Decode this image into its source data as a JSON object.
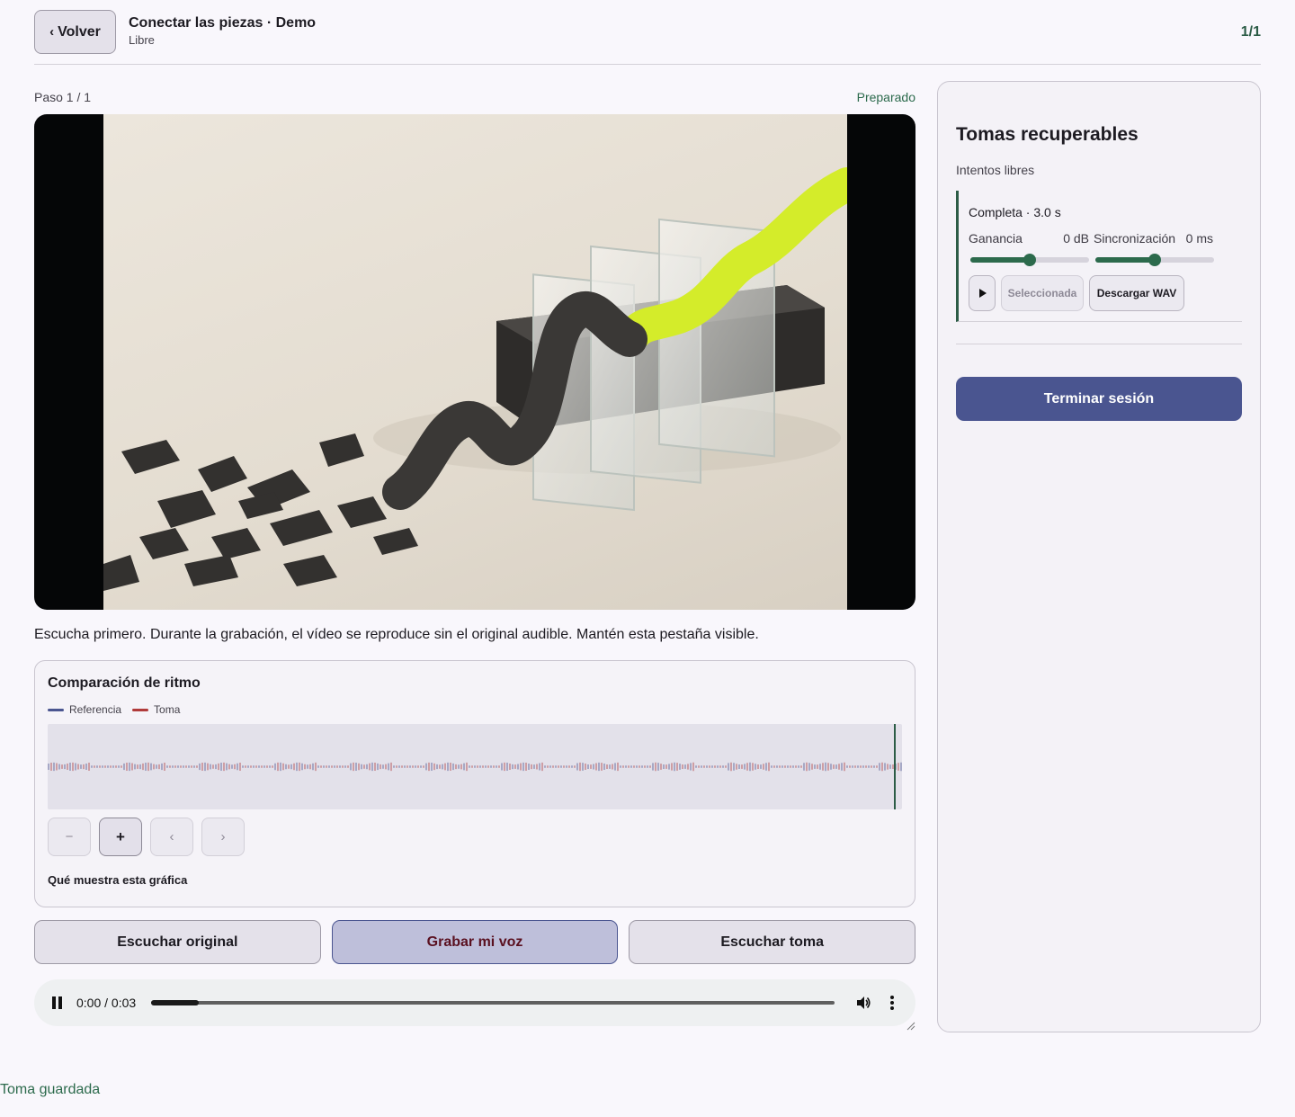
{
  "header": {
    "back_label": "Volver",
    "title": "Conectar las piezas · Demo",
    "subtitle": "Libre",
    "counter": "1/1"
  },
  "step": {
    "label": "Paso 1 / 1",
    "status": "Preparado"
  },
  "instructions": "Escucha primero. Durante la grabación, el vídeo se reproduce sin el original audible. Mantén esta pestaña visible.",
  "rhythm": {
    "title": "Comparación de ritmo",
    "legend": [
      {
        "label": "Referencia",
        "color": "#4a5590"
      },
      {
        "label": "Toma",
        "color": "#b03a3a"
      }
    ],
    "controls": {
      "zoom_out": "−",
      "zoom_in": "+",
      "prev": "‹",
      "next": "›"
    },
    "help_label": "Qué muestra esta gráfica"
  },
  "actions": {
    "listen_original": "Escuchar original",
    "record": "Grabar mi voz",
    "listen_take": "Escuchar toma"
  },
  "player": {
    "time": "0:00 / 0:03",
    "progress": 0.07
  },
  "side": {
    "title": "Tomas recuperables",
    "subtitle": "Intentos libres",
    "take": {
      "name": "Completa · 3.0 s",
      "gain_label": "Ganancia",
      "gain_value": "0 dB",
      "gain_level": 0.5,
      "sync_label": "Sincronización",
      "sync_value": "0 ms",
      "sync_level": 0.5,
      "selected_label": "Seleccionada",
      "download_label": "Descargar WAV"
    },
    "end_label": "Terminar sesión"
  },
  "toast": "Toma guardada",
  "colors": {
    "accent": "#4a5590",
    "success": "#2c6a4c",
    "record_text": "#5a1020"
  }
}
